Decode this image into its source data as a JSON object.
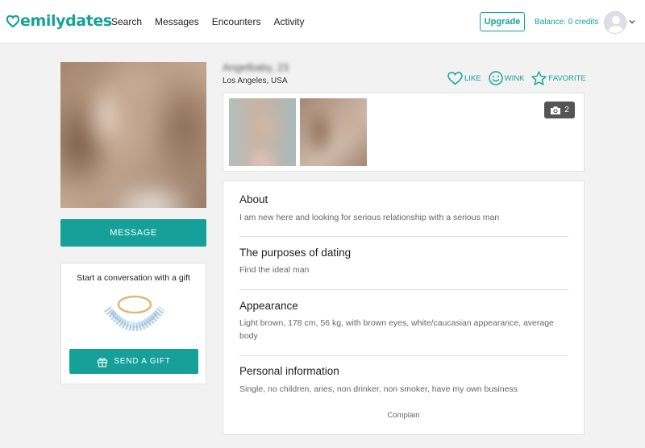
{
  "header": {
    "logo_text": "emilydates",
    "nav": [
      "Search",
      "Messages",
      "Encounters",
      "Activity"
    ],
    "upgrade_label": "Upgrade",
    "balance": "Balance: 0 credits"
  },
  "profile": {
    "location": "Los Angeles, USA",
    "message_label": "MESSAGE",
    "actions": {
      "like": "LIKE",
      "wink": "WINK",
      "favorite": "FAVORITE"
    },
    "photo_count": "2"
  },
  "gift": {
    "title": "Start a conversation with a gift",
    "button_label": "SEND A GIFT"
  },
  "info": {
    "about_title": "About",
    "about_text": "I am new here and looking for serious relationship with a serious man",
    "purposes_title": "The purposes of dating",
    "purposes_text": "Find the ideal man",
    "appearance_title": "Appearance",
    "appearance_text": "Light brown, 178 cm, 56 kg, with brown eyes, white/caucasian appearance, average body",
    "personal_title": "Personal information",
    "personal_text": "Single, no children, aries, non drinker, non smoker, have my own business",
    "complain_label": "Complain"
  },
  "colors": {
    "accent": "#15a19a",
    "background": "#f2f2f2"
  }
}
